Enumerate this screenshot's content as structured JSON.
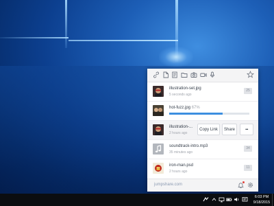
{
  "toolbar": {
    "tools": [
      {
        "name": "link-icon"
      },
      {
        "name": "file-icon"
      },
      {
        "name": "note-icon"
      },
      {
        "name": "folder-icon"
      },
      {
        "name": "camera-icon"
      },
      {
        "name": "video-icon"
      },
      {
        "name": "microphone-icon"
      }
    ],
    "favorite_icon": "star-icon"
  },
  "files": [
    {
      "name": "illustration-set.jpg",
      "time": "5 seconds ago",
      "count": "25",
      "thumb": "dark-illustration"
    },
    {
      "name": "hot-fuzz.jpg",
      "progress_text": "67%",
      "progress": 0.67,
      "thumb": "movie-still"
    },
    {
      "name": "illustration-...",
      "time": "2 hours ago",
      "thumb": "dark-illustration",
      "actions": [
        "Copy Link",
        "Share",
        "•••"
      ]
    },
    {
      "name": "soundtrack-intro.mp3",
      "time": "35 minutes ago",
      "count": "34",
      "thumb": "music-note-icon"
    },
    {
      "name": "iron-man.psd",
      "time": "2 hours ago",
      "count": "11",
      "thumb": "comic-art"
    }
  ],
  "footer": {
    "site": "jumpshare.com",
    "icons": [
      "bell-icon",
      "gear-icon"
    ]
  },
  "taskbar": {
    "time": "6:03 PM",
    "date": "9/18/2015",
    "tray_icons": [
      "jumpshare-tray-icon",
      "chevron-up-icon",
      "network-icon",
      "battery-icon",
      "volume-icon",
      "action-center-icon"
    ]
  },
  "colors": {
    "accent": "#3d8fe0",
    "notification": "#e0413a",
    "taskbar": "#0b0d10"
  }
}
